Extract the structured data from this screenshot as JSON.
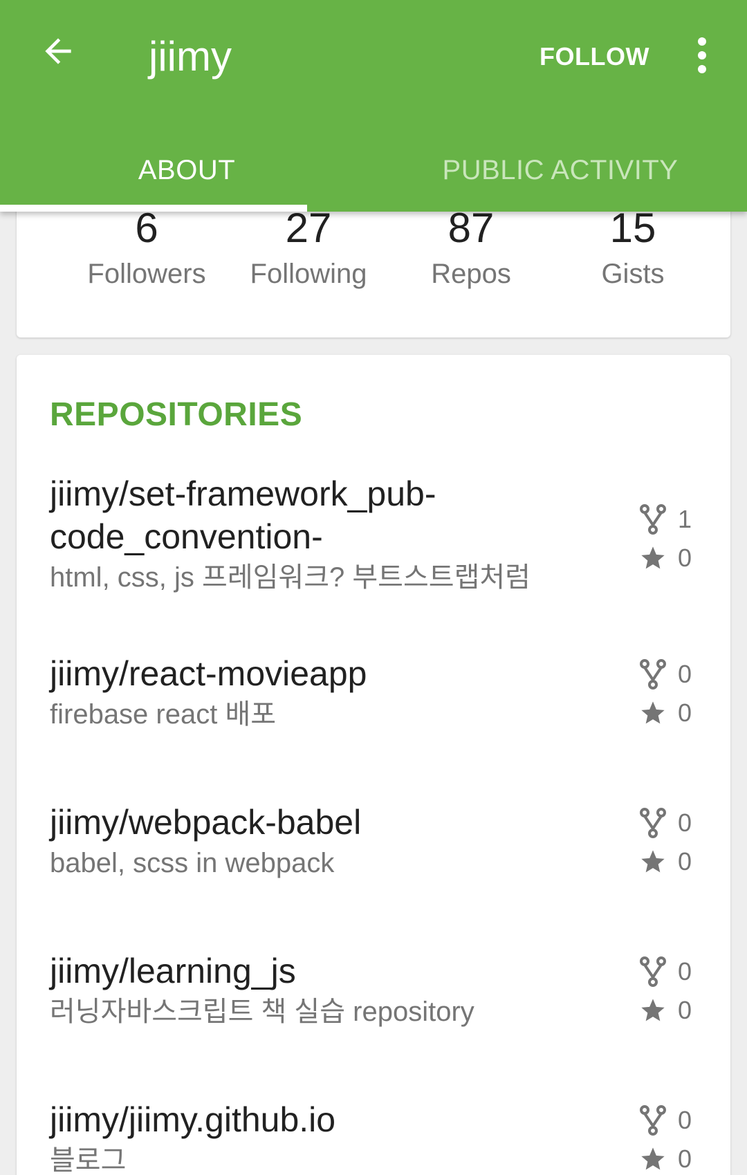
{
  "appbar": {
    "title": "jiimy",
    "follow_label": "FOLLOW",
    "back_icon": "arrow-left-icon",
    "more_icon": "more-vert-icon",
    "color": "#67b346"
  },
  "tabs": [
    {
      "label": "ABOUT",
      "active": true
    },
    {
      "label": "PUBLIC ACTIVITY",
      "active": false
    }
  ],
  "stats": [
    {
      "value": "6",
      "label": "Followers"
    },
    {
      "value": "27",
      "label": "Following"
    },
    {
      "value": "87",
      "label": "Repos"
    },
    {
      "value": "15",
      "label": "Gists"
    }
  ],
  "repositories": {
    "title": "REPOSITORIES",
    "items": [
      {
        "name": "jiimy/set-framework_pub-code_convention-",
        "description": "html, css, js 프레임워크? 부트스트랩처럼",
        "forks": "1",
        "stars": "0"
      },
      {
        "name": "jiimy/react-movieapp",
        "description": "firebase react 배포",
        "forks": "0",
        "stars": "0"
      },
      {
        "name": "jiimy/webpack-babel",
        "description": "babel, scss in webpack",
        "forks": "0",
        "stars": "0"
      },
      {
        "name": "jiimy/learning_js",
        "description": "러닝자바스크립트 책 실습 repository",
        "forks": "0",
        "stars": "0"
      },
      {
        "name": "jiimy/jiimy.github.io",
        "description": "블로그",
        "forks": "0",
        "stars": "0"
      }
    ]
  }
}
